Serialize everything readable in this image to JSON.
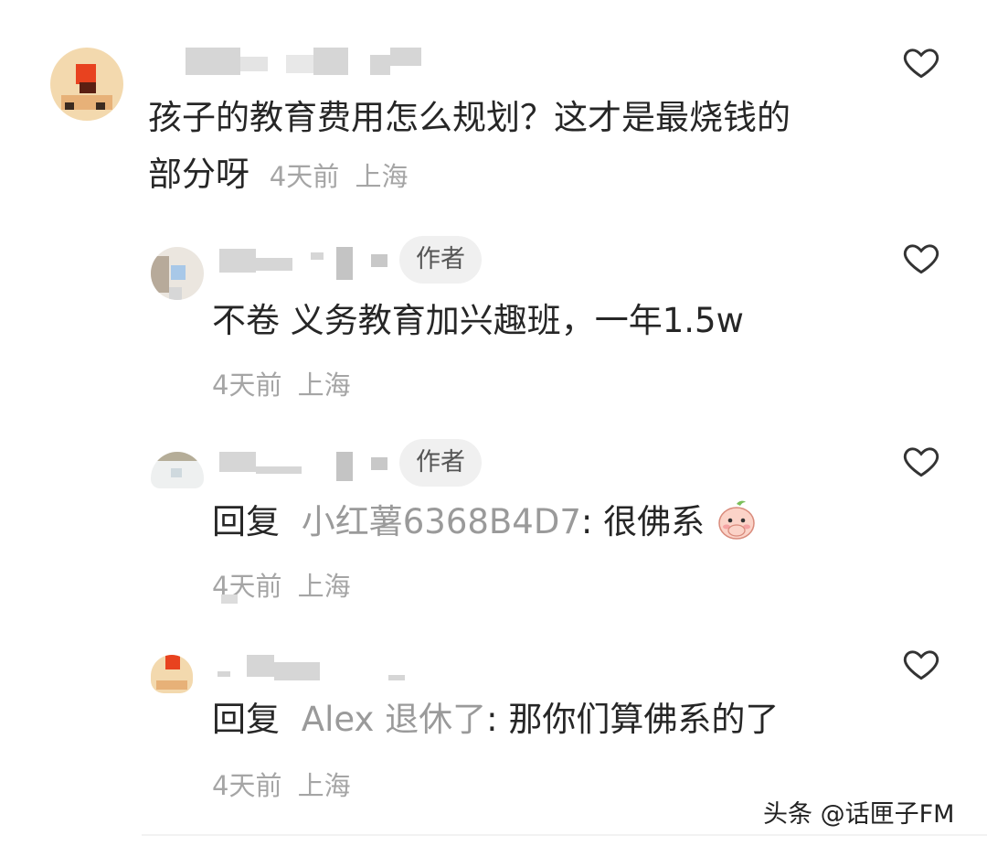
{
  "comments": [
    {
      "text": "孩子的教育费用怎么规划？这才是最烧钱的部分呀",
      "text_line1": "孩子的教育费用怎么规划？这才是最烧钱的",
      "text_line2": "部分呀",
      "time": "4天前",
      "location": "上海"
    },
    {
      "badge": "作者",
      "text": "不卷 义务教育加兴趣班，一年1.5w",
      "time": "4天前",
      "location": "上海"
    },
    {
      "badge": "作者",
      "reply_prefix": "回复",
      "reply_to": "小红薯6368B4D7",
      "reply_sep": ":",
      "text": "很佛系",
      "emoji": "covering-mouth-emoji",
      "time": "4天前",
      "location": "上海"
    },
    {
      "reply_prefix": "回复",
      "reply_to": "Alex 退休了",
      "reply_sep": ":",
      "text": "那你们算佛系的了",
      "time": "4天前",
      "location": "上海"
    }
  ],
  "icons": {
    "like": "heart-outline-icon"
  },
  "watermark": "头条 @话匣子FM"
}
